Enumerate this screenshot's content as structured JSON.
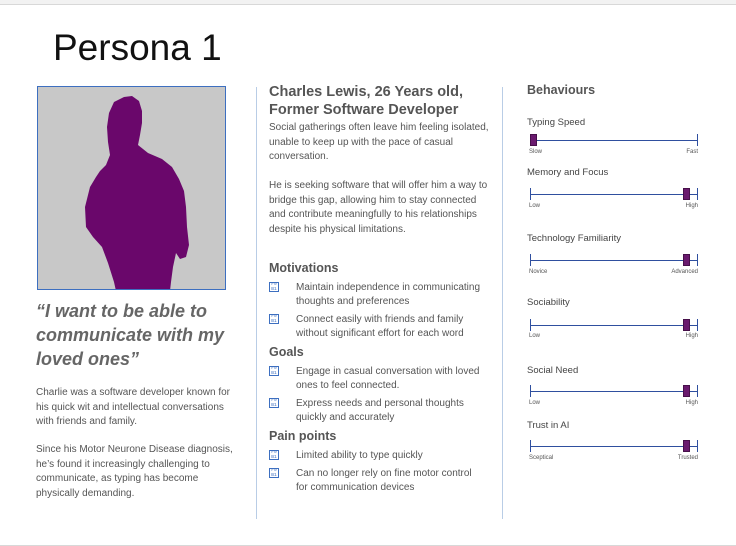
{
  "title": "Persona 1",
  "quote": "“I want to be able to communicate with my loved ones”",
  "bio": [
    "Charlie was a software developer known for his quick wit and intellectual conversations with friends and family.",
    "Since his Motor Neurone Disease diagnosis, he’s found it increasingly challenging to communicate, as typing has become physically demanding."
  ],
  "profile": {
    "name": "Charles Lewis, 26 Years old, Former Software Developer",
    "paragraphs": [
      "Social gatherings often leave him feeling isolated, unable to keep up with the pace of casual conversation.",
      "He is seeking software that will offer him a way to bridge this gap, allowing him to stay connected and contribute meaningfully to his relationships despite his physical limitations."
    ]
  },
  "motivations": {
    "heading": "Motivations",
    "items": [
      "Maintain independence in communicating thoughts and preferences",
      "Connect easily with friends and family without significant effort for each word"
    ]
  },
  "goals": {
    "heading": "Goals",
    "items": [
      "Engage in casual conversation with loved ones to feel connected.",
      "Express needs and personal thoughts quickly and accurately"
    ]
  },
  "pain_points": {
    "heading": "Pain points",
    "items": [
      "Limited ability to type quickly",
      "Can no longer rely on fine motor control for communication devices"
    ]
  },
  "bullet_icon_text": "F0 B1",
  "behaviours": {
    "heading": "Behaviours",
    "thumb_color": "#6a1a6e",
    "track_color": "#2f4f9f",
    "sliders": [
      {
        "label": "Typing Speed",
        "min": "Slow",
        "max": "Fast",
        "value": 0.0
      },
      {
        "label": "Memory and Focus",
        "min": "Low",
        "max": "High",
        "value": 0.95
      },
      {
        "label": "Technology Familiarity",
        "min": "Novice",
        "max": "Advanced",
        "value": 0.95
      },
      {
        "label": "Sociability",
        "min": "Low",
        "max": "High",
        "value": 0.95
      },
      {
        "label": "Social Need",
        "min": "Low",
        "max": "High",
        "value": 0.95
      },
      {
        "label": "Trust in AI",
        "min": "Sceptical",
        "max": "Trusted",
        "value": 0.95
      }
    ]
  }
}
